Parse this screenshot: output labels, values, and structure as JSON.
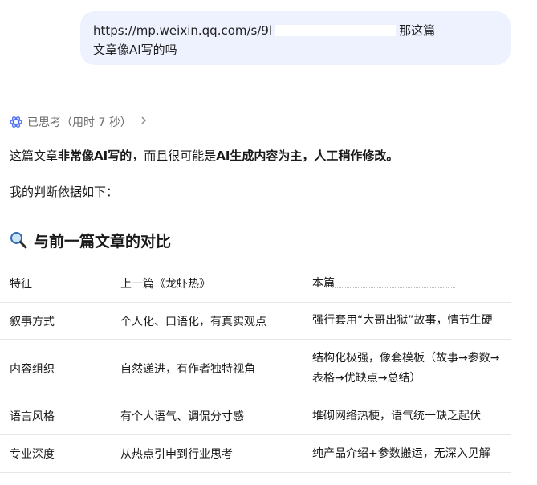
{
  "user_message": {
    "url_prefix": "https://mp.weixin.qq.com/s/9l",
    "text_suffix": "那这篇",
    "line2": "文章像AI写的吗"
  },
  "thinking": {
    "label": "已思考（用时 7 秒）"
  },
  "answer": {
    "lead_1": "这篇文章",
    "lead_bold_1": "非常像AI写的",
    "lead_2": "，而且很可能是",
    "lead_bold_2": "AI生成内容为主，人工稍作修改。",
    "basis": "我的判断依据如下："
  },
  "section": {
    "title": "与前一篇文章的对比"
  },
  "table": {
    "headers": [
      "特征",
      "上一篇《龙虾热》",
      "本篇"
    ],
    "rows": [
      [
        "叙事方式",
        "个人化、口语化，有真实观点",
        "强行套用“大哥出狱”故事，情节生硬"
      ],
      [
        "内容组织",
        "自然递进，有作者独特视角",
        "结构化极强，像套模板（故事→参数→表格→优缺点→总结）"
      ],
      [
        "语言风格",
        "有个人语气、调侃分寸感",
        "堆砌网络热梗，语气统一缺乏起伏"
      ],
      [
        "专业深度",
        "从热点引申到行业思考",
        "纯产品介绍+参数搬运，无深入见解"
      ]
    ]
  }
}
